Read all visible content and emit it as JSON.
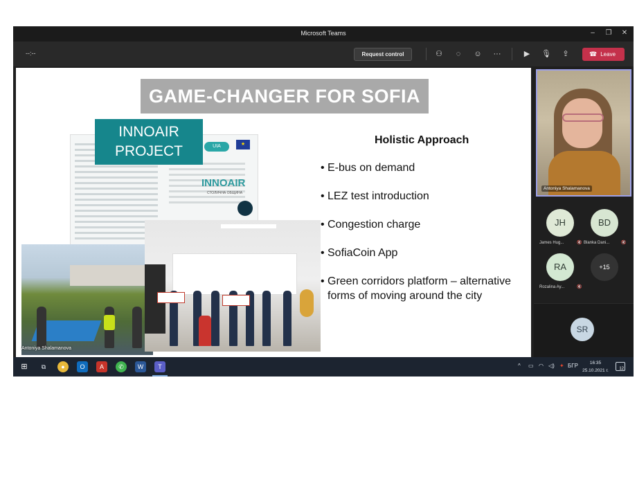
{
  "window": {
    "title": "Microsoft Teams"
  },
  "toolbar": {
    "timer": "--:--",
    "request_control_label": "Request control",
    "leave_label": "Leave"
  },
  "slide": {
    "title": "GAME-CHANGER FOR SOFIA",
    "innoair_badge_line1": "INNOAIR",
    "innoair_badge_line2": "PROJECT",
    "poster_brand": "INNOAIR",
    "poster_subtitle": "СТОЛИЧНА ОБЩИНА",
    "uia_label": "UIA",
    "holistic_heading": "Holistic Approach",
    "bullets": [
      "E-bus on demand",
      "LEZ test introduction",
      "Congestion charge",
      "SofiaCoin App",
      "Green corridors platform – alternative forms of moving around the city"
    ],
    "presenter_caption": "Antoniya Shalamanova"
  },
  "participants": {
    "presenter": {
      "name": "Antoniya Shalamanova"
    },
    "people": [
      {
        "initials": "JH",
        "name": "James Hug...",
        "color": "#dfe9d6"
      },
      {
        "initials": "BD",
        "name": "Blanka Dani...",
        "color": "#d7e6d2"
      },
      {
        "initials": "RA",
        "name": "Rozalina Ay...",
        "color": "#d3e8d2"
      }
    ],
    "more_count": "+15",
    "bottom_initials": "SR"
  },
  "taskbar": {
    "language": "БГР",
    "time": "16:35",
    "date": "25.10.2021 г.",
    "notifications": "12"
  }
}
